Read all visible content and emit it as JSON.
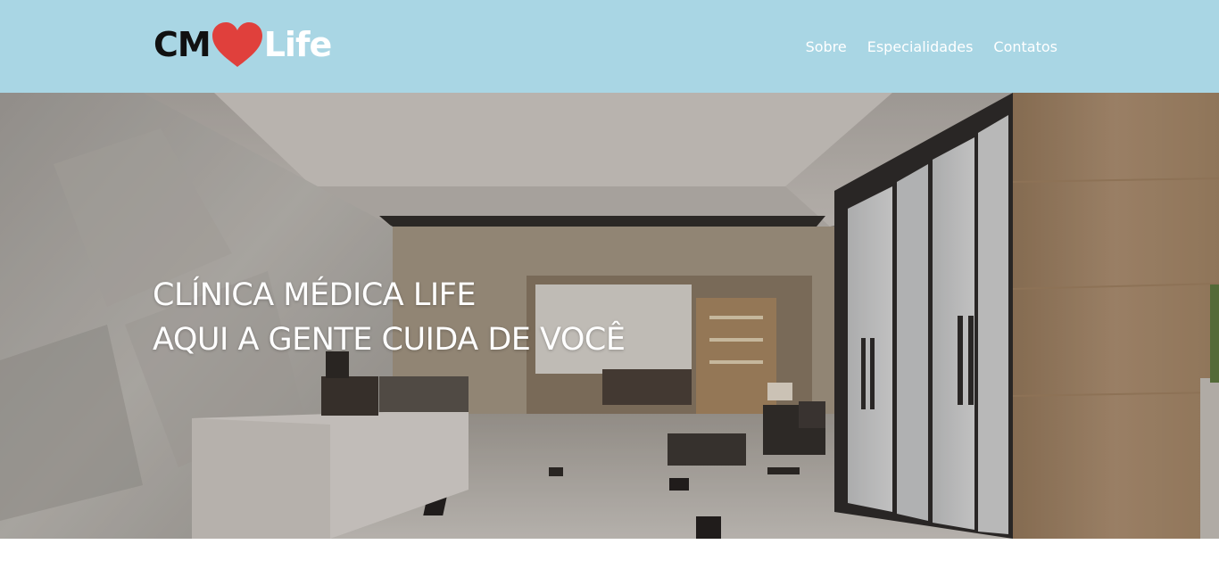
{
  "header": {
    "logo": {
      "part1": "CM",
      "part2": "Life",
      "heart_color": "#e0403c",
      "heart_icon": "heart-icon"
    },
    "nav": [
      {
        "label": "Sobre"
      },
      {
        "label": "Especialidades"
      },
      {
        "label": "Contatos"
      }
    ],
    "background": "#a9d6e4"
  },
  "hero": {
    "line1": "CLÍNICA MÉDICA LIFE",
    "line2": "AQUI A GENTE CUIDA DE VOCÊ",
    "image": "clinic-lobby-photo"
  }
}
